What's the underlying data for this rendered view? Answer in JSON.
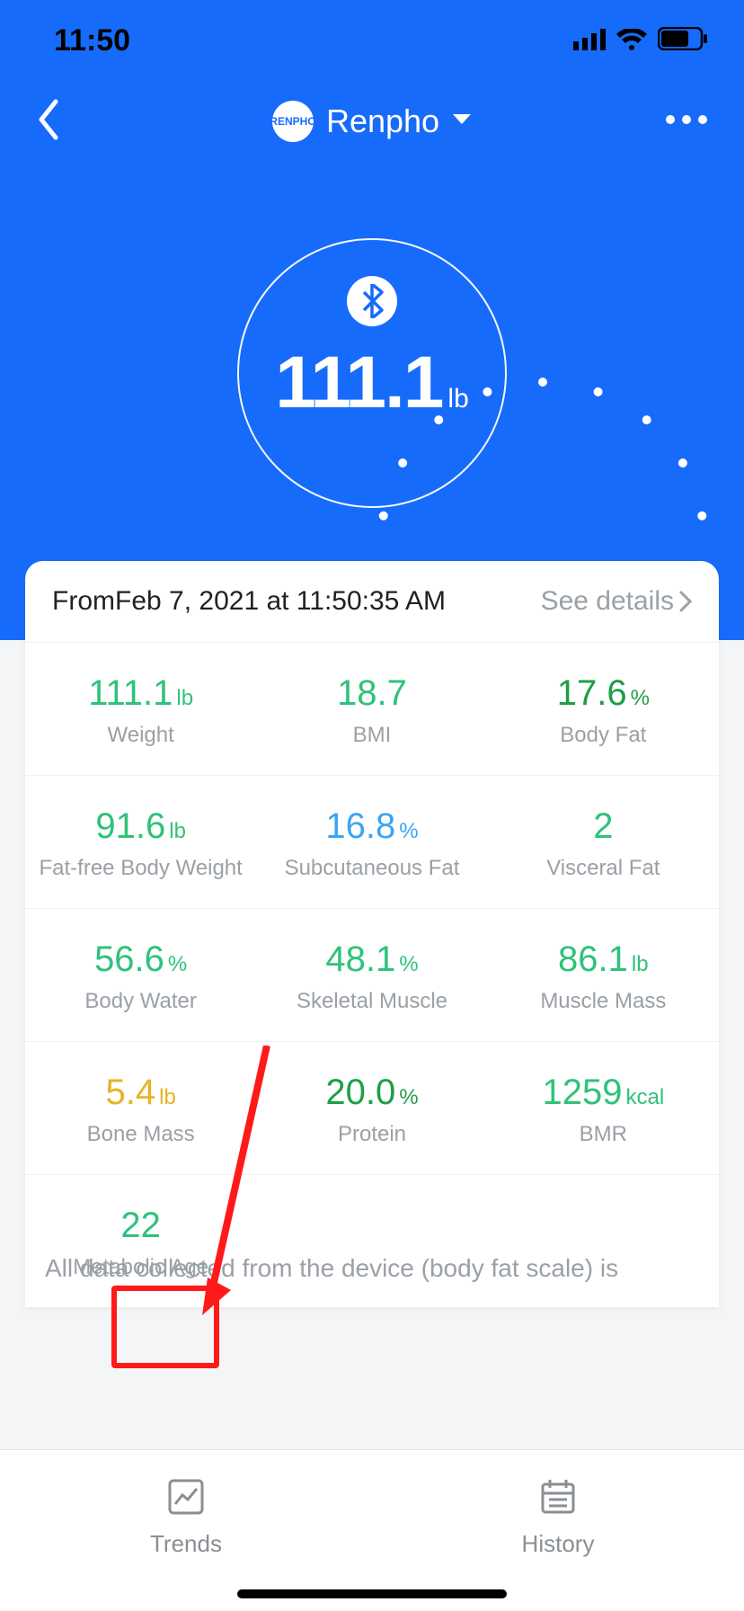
{
  "status": {
    "time": "11:50"
  },
  "header": {
    "title": "Renpho",
    "brand_mark": "RENPHO"
  },
  "display": {
    "weight_value": "111.1",
    "weight_unit": "lb"
  },
  "card": {
    "from_prefix": "From",
    "from_text": "Feb 7, 2021 at 11:50:35 AM",
    "see_details": "See details"
  },
  "metrics": [
    {
      "value": "111.1",
      "unit": "lb",
      "label": "Weight",
      "color": "c-green"
    },
    {
      "value": "18.7",
      "unit": "",
      "label": "BMI",
      "color": "c-green"
    },
    {
      "value": "17.6",
      "unit": "%",
      "label": "Body Fat",
      "color": "c-dgreen"
    },
    {
      "value": "91.6",
      "unit": "lb",
      "label": "Fat-free Body Weight",
      "color": "c-green"
    },
    {
      "value": "16.8",
      "unit": "%",
      "label": "Subcutaneous Fat",
      "color": "c-blue"
    },
    {
      "value": "2",
      "unit": "",
      "label": "Visceral Fat",
      "color": "c-green"
    },
    {
      "value": "56.6",
      "unit": "%",
      "label": "Body Water",
      "color": "c-green"
    },
    {
      "value": "48.1",
      "unit": "%",
      "label": "Skeletal Muscle",
      "color": "c-green"
    },
    {
      "value": "86.1",
      "unit": "lb",
      "label": "Muscle Mass",
      "color": "c-green"
    },
    {
      "value": "5.4",
      "unit": "lb",
      "label": "Bone Mass",
      "color": "c-yellow"
    },
    {
      "value": "20.0",
      "unit": "%",
      "label": "Protein",
      "color": "c-dgreen"
    },
    {
      "value": "1259",
      "unit": "kcal",
      "label": "BMR",
      "color": "c-green"
    },
    {
      "value": "22",
      "unit": "",
      "label": "Metabolic Age",
      "color": "c-green"
    }
  ],
  "footnote": "All data collected from the device (body fat scale) is",
  "tabs": {
    "trends": "Trends",
    "history": "History"
  }
}
